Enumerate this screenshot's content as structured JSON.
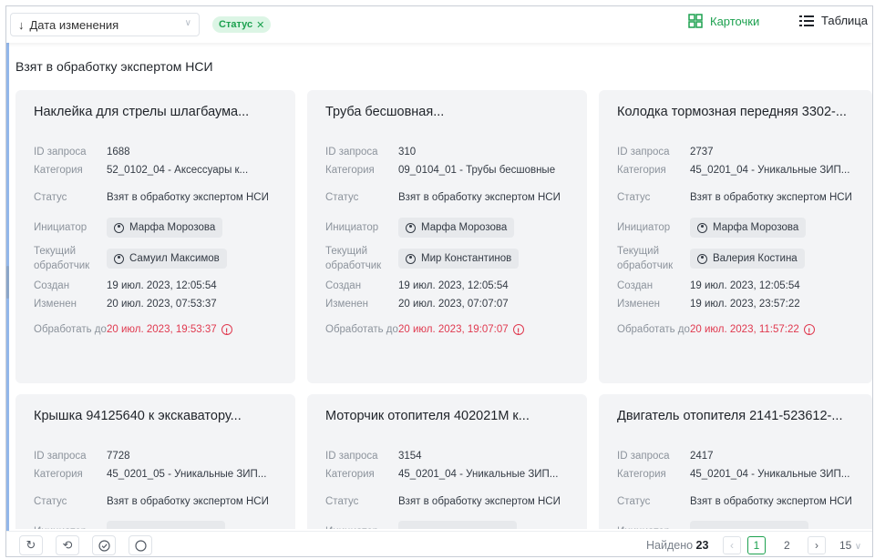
{
  "toolbar": {
    "sort_label": "Дата изменения",
    "filter_chip": "Статус",
    "view_cards": "Карточки",
    "view_table": "Таблица"
  },
  "section_title": "Взят в обработку экспертом НСИ",
  "labels": {
    "id": "ID запроса",
    "category": "Категория",
    "status": "Статус",
    "initiator": "Инициатор",
    "handler": "Текущий обработчик",
    "created": "Создан",
    "modified": "Изменен",
    "deadline": "Обработать до"
  },
  "cards": [
    {
      "title": "Наклейка для стрелы шлагбаума...",
      "id": "1688",
      "category": "52_0102_04 - Аксессуары к...",
      "status": "Взят в обработку экспертом НСИ",
      "initiator": "Марфа Морозова",
      "handler": "Самуил Максимов",
      "created": "19 июл. 2023, 12:05:54",
      "modified": "20 июл. 2023, 07:53:37",
      "deadline": "20 июл. 2023, 19:53:37"
    },
    {
      "title": "Труба бесшовная...",
      "id": "310",
      "category": "09_0104_01 - Трубы бесшовные",
      "status": "Взят в обработку экспертом НСИ",
      "initiator": "Марфа Морозова",
      "handler": "Мир Константинов",
      "created": "19 июл. 2023, 12:05:54",
      "modified": "20 июл. 2023, 07:07:07",
      "deadline": "20 июл. 2023, 19:07:07"
    },
    {
      "title": "Колодка тормозная передняя 3302-...",
      "id": "2737",
      "category": "45_0201_04 - Уникальные ЗИП...",
      "status": "Взят в обработку экспертом НСИ",
      "initiator": "Марфа Морозова",
      "handler": "Валерия Костина",
      "created": "19 июл. 2023, 12:05:54",
      "modified": "19 июл. 2023, 23:57:22",
      "deadline": "20 июл. 2023, 11:57:22"
    },
    {
      "title": "Крышка 94125640 к экскаватору...",
      "id": "7728",
      "category": "45_0201_05 - Уникальные ЗИП...",
      "status": "Взят в обработку экспертом НСИ"
    },
    {
      "title": "Моторчик отопителя 402021М к...",
      "id": "3154",
      "category": "45_0201_04 - Уникальные ЗИП...",
      "status": "Взят в обработку экспертом НСИ"
    },
    {
      "title": "Двигатель отопителя 2141-523612-...",
      "id": "2417",
      "category": "45_0201_04 - Уникальные ЗИП...",
      "status": "Взят в обработку экспертом НСИ"
    }
  ],
  "footer": {
    "found_label": "Найдено",
    "found_count": "23",
    "pages": [
      "1",
      "2"
    ],
    "current_page": "1",
    "page_size": "15"
  },
  "colors": {
    "accent": "#1ca14f",
    "deadline": "#e0394f",
    "card_bg": "#f3f4f6"
  }
}
